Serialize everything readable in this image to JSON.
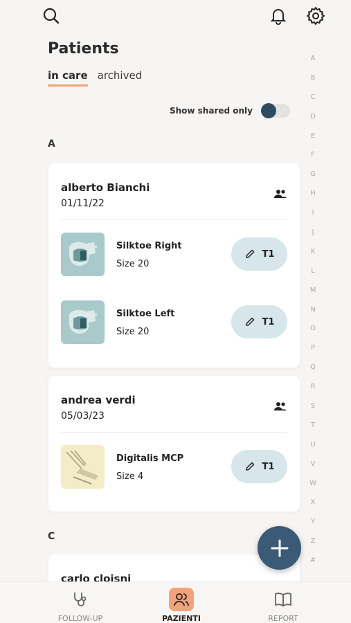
{
  "page": {
    "title": "Patients"
  },
  "tabs": [
    {
      "label": "in care",
      "active": true
    },
    {
      "label": "archived",
      "active": false
    }
  ],
  "filter": {
    "shared_label": "Show shared only",
    "shared_on": false
  },
  "alphabet": [
    "A",
    "B",
    "C",
    "D",
    "E",
    "F",
    "G",
    "H",
    "I",
    "J",
    "K",
    "L",
    "M",
    "N",
    "O",
    "P",
    "Q",
    "R",
    "S",
    "T",
    "U",
    "V",
    "W",
    "X",
    "Y",
    "Z",
    "#"
  ],
  "sections": [
    {
      "letter": "A",
      "patients": [
        {
          "name": "alberto Bianchi",
          "date": "01/11/22",
          "products": [
            {
              "name": "Silktoe Right",
              "size": "Size 20",
              "badge": "T1",
              "thumb": "silktoe"
            },
            {
              "name": "Silktoe Left",
              "size": "Size 20",
              "badge": "T1",
              "thumb": "silktoe"
            }
          ]
        },
        {
          "name": "andrea verdi",
          "date": "05/03/23",
          "products": [
            {
              "name": "Digitalis MCP",
              "size": "Size 4",
              "badge": "T1",
              "thumb": "digitalis"
            }
          ]
        }
      ]
    },
    {
      "letter": "C",
      "patients": [
        {
          "name": "carlo cloisni"
        }
      ]
    }
  ],
  "nav": [
    {
      "label": "FOLLOW-UP",
      "icon": "stethoscope-icon",
      "active": false
    },
    {
      "label": "PAZIENTI",
      "icon": "users-icon",
      "active": true
    },
    {
      "label": "REPORT",
      "icon": "book-icon",
      "active": false
    }
  ],
  "colors": {
    "accent": "#f1a47b",
    "primary": "#3a5a75",
    "badge_bg": "#d6e6ea"
  }
}
